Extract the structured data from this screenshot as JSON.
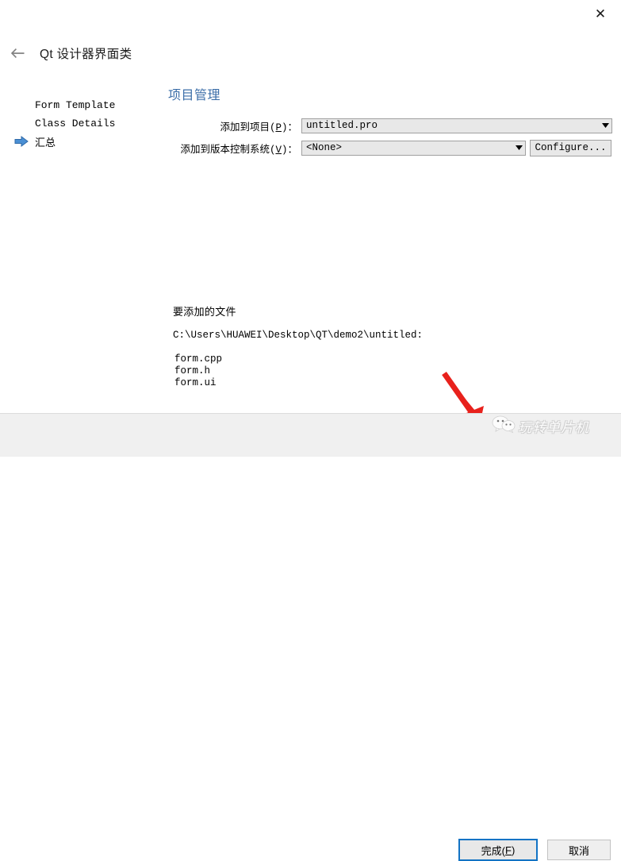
{
  "window": {
    "close_label": "✕"
  },
  "header": {
    "back_icon": "back-arrow-icon",
    "title": "Qt 设计器界面类"
  },
  "sidebar": {
    "steps": [
      {
        "label": "Form Template",
        "current": false
      },
      {
        "label": "Class Details",
        "current": false
      },
      {
        "label": "汇总",
        "current": true
      }
    ],
    "current_marker_icon": "blue-right-arrow-icon",
    "current_marker_color": "#3a7ac8"
  },
  "main": {
    "page_title": "项目管理",
    "page_title_color": "#3b6ea8",
    "fields": {
      "project": {
        "label_prefix": "添加到项目(",
        "label_mnemonic": "P",
        "label_suffix": ")：",
        "value": "untitled.pro",
        "arrow_icon": "chevron-down-icon"
      },
      "vcs": {
        "label_prefix": "添加到版本控制系统(",
        "label_mnemonic": "V",
        "label_suffix": ")：",
        "value": "<None>",
        "arrow_icon": "chevron-down-icon"
      },
      "configure_button": "Configure..."
    }
  },
  "files": {
    "heading": "要添加的文件",
    "path": "C:\\Users\\HUAWEI\\Desktop\\QT\\demo2\\untitled:",
    "items": [
      "form.cpp",
      "form.h",
      "form.ui"
    ]
  },
  "footer": {
    "finish": {
      "prefix": "完成(",
      "mnemonic": "F",
      "suffix": ")",
      "focus_color": "#1273c4"
    },
    "cancel": {
      "label": "取消"
    }
  },
  "annotation": {
    "arrow_icon": "red-arrow-icon",
    "arrow_color": "#e8211c",
    "points_to": "finish-button"
  },
  "watermark": {
    "text": "玩转单片机",
    "icon": "wechat-icon"
  }
}
